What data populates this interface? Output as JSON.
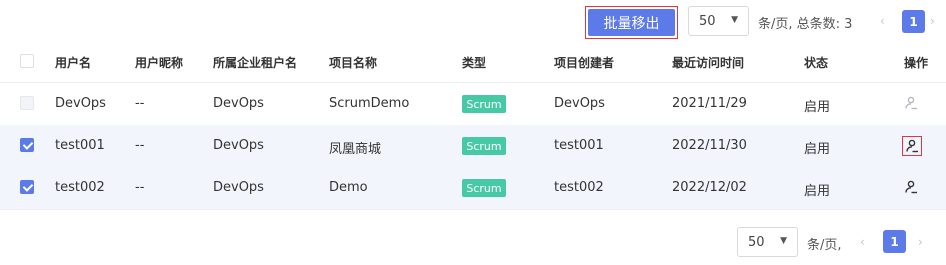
{
  "toolbar": {
    "batch_button_label": "批量移出",
    "page_size": "50",
    "per_page_text": "条/页, 总条数: 3",
    "current_page": "1"
  },
  "table": {
    "headers": [
      "用户名",
      "用户昵称",
      "所属企业租户名",
      "项目名称",
      "类型",
      "项目创建者",
      "最近访问时间",
      "状态",
      "操作"
    ],
    "rows": [
      {
        "checkbox": "disabled",
        "username": "DevOps",
        "nickname": "--",
        "tenant": "DevOps",
        "project": "ScrumDemo",
        "type": "Scrum",
        "creator": "DevOps",
        "last_visit": "2021/11/29",
        "status": "启用"
      },
      {
        "checkbox": "checked",
        "username": "test001",
        "nickname": "--",
        "tenant": "DevOps",
        "project": "凤凰商城",
        "type": "Scrum",
        "creator": "test001",
        "last_visit": "2022/11/30",
        "status": "启用"
      },
      {
        "checkbox": "checked",
        "username": "test002",
        "nickname": "--",
        "tenant": "DevOps",
        "project": "Demo",
        "type": "Scrum",
        "creator": "test002",
        "last_visit": "2022/12/02",
        "status": "启用"
      }
    ]
  },
  "footer": {
    "page_size": "50",
    "per_page_text": "条/页,",
    "current_page": "1"
  },
  "colors": {
    "accent": "#5c7ae8",
    "tag": "#48c9a5",
    "highlight_border": "#e0383e",
    "selected_row": "#f3f5fd"
  },
  "icons": {
    "operation": "remove-user-icon",
    "caret": "caret-down-icon",
    "prev": "chevron-left-icon",
    "next": "chevron-right-icon"
  }
}
